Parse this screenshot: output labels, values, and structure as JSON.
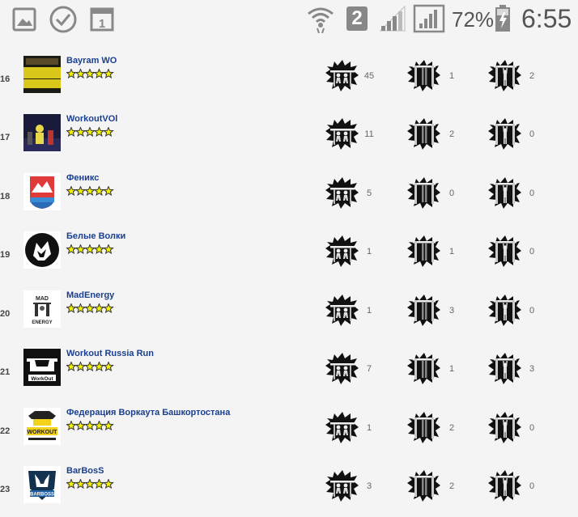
{
  "status_bar": {
    "icons": [
      "gallery-icon",
      "check-circle-icon",
      "calendar-icon",
      "wifi-icon",
      "sim-icon",
      "signal-icon",
      "signal-icon",
      "battery-icon"
    ],
    "sim_number": "2",
    "battery_percent": "72%",
    "time": "6:55"
  },
  "teams": [
    {
      "rank": "16",
      "name": "Bayram WO",
      "stars": 5,
      "stat1": "45",
      "stat2": "1",
      "stat3": "2",
      "logo": "bayram-logo"
    },
    {
      "rank": "17",
      "name": "WorkoutVOl",
      "stars": 5,
      "stat1": "11",
      "stat2": "2",
      "stat3": "0",
      "logo": "workoutvol-logo"
    },
    {
      "rank": "18",
      "name": "Феникс",
      "stars": 5,
      "stat1": "5",
      "stat2": "0",
      "stat3": "0",
      "logo": "feniks-logo"
    },
    {
      "rank": "19",
      "name": "Белые Волки",
      "stars": 5,
      "stat1": "1",
      "stat2": "1",
      "stat3": "0",
      "logo": "wolves-logo"
    },
    {
      "rank": "20",
      "name": "MadEnergy",
      "stars": 5,
      "stat1": "1",
      "stat2": "3",
      "stat3": "0",
      "logo": "madenergy-logo"
    },
    {
      "rank": "21",
      "name": "Workout Russia Run",
      "stars": 5,
      "stat1": "7",
      "stat2": "1",
      "stat3": "3",
      "logo": "workout-russia-logo"
    },
    {
      "rank": "22",
      "name": "Федерация Воркаута Башкортостана",
      "stars": 5,
      "stat1": "1",
      "stat2": "2",
      "stat3": "0",
      "logo": "bashkortostan-logo"
    },
    {
      "rank": "23",
      "name": "BarBosS",
      "stars": 5,
      "stat1": "3",
      "stat2": "2",
      "stat3": "0",
      "logo": "barboss-logo"
    }
  ],
  "colors": {
    "name_link": "#1a3f8e",
    "star_fill": "#f2f200",
    "star_outline": "#333333"
  }
}
